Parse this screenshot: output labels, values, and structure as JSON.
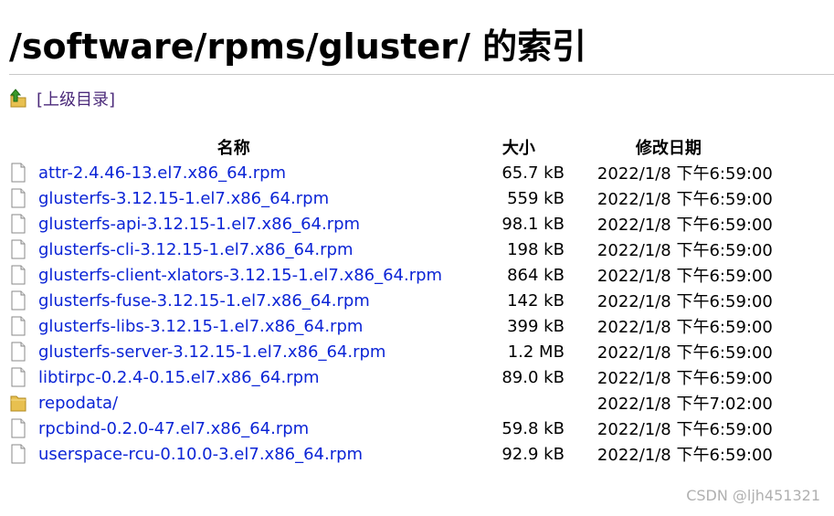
{
  "page": {
    "title": "/software/rpms/gluster/ 的索引",
    "parent_link": "[上级目录]"
  },
  "table": {
    "headers": {
      "name": "名称",
      "size": "大小",
      "date": "修改日期"
    },
    "rows": [
      {
        "name": "attr-2.4.46-13.el7.x86_64.rpm",
        "size": "65.7 kB",
        "date": "2022/1/8 下午6:59:00",
        "icon": "file-icon"
      },
      {
        "name": "glusterfs-3.12.15-1.el7.x86_64.rpm",
        "size": "559 kB",
        "date": "2022/1/8 下午6:59:00",
        "icon": "file-icon"
      },
      {
        "name": "glusterfs-api-3.12.15-1.el7.x86_64.rpm",
        "size": "98.1 kB",
        "date": "2022/1/8 下午6:59:00",
        "icon": "file-icon"
      },
      {
        "name": "glusterfs-cli-3.12.15-1.el7.x86_64.rpm",
        "size": "198 kB",
        "date": "2022/1/8 下午6:59:00",
        "icon": "file-icon"
      },
      {
        "name": "glusterfs-client-xlators-3.12.15-1.el7.x86_64.rpm",
        "size": "864 kB",
        "date": "2022/1/8 下午6:59:00",
        "icon": "file-icon"
      },
      {
        "name": "glusterfs-fuse-3.12.15-1.el7.x86_64.rpm",
        "size": "142 kB",
        "date": "2022/1/8 下午6:59:00",
        "icon": "file-icon"
      },
      {
        "name": "glusterfs-libs-3.12.15-1.el7.x86_64.rpm",
        "size": "399 kB",
        "date": "2022/1/8 下午6:59:00",
        "icon": "file-icon"
      },
      {
        "name": "glusterfs-server-3.12.15-1.el7.x86_64.rpm",
        "size": "1.2 MB",
        "date": "2022/1/8 下午6:59:00",
        "icon": "file-icon"
      },
      {
        "name": "libtirpc-0.2.4-0.15.el7.x86_64.rpm",
        "size": "89.0 kB",
        "date": "2022/1/8 下午6:59:00",
        "icon": "file-icon"
      },
      {
        "name": "repodata/",
        "size": "",
        "date": "2022/1/8 下午7:02:00",
        "icon": "folder-icon"
      },
      {
        "name": "rpcbind-0.2.0-47.el7.x86_64.rpm",
        "size": "59.8 kB",
        "date": "2022/1/8 下午6:59:00",
        "icon": "file-icon"
      },
      {
        "name": "userspace-rcu-0.10.0-3.el7.x86_64.rpm",
        "size": "92.9 kB",
        "date": "2022/1/8 下午6:59:00",
        "icon": "file-icon"
      }
    ]
  },
  "watermark": "CSDN @ljh451321",
  "colors": {
    "link": "#0b24d6",
    "visited_link": "#4b2a7a",
    "rule": "#c8c8c8"
  }
}
